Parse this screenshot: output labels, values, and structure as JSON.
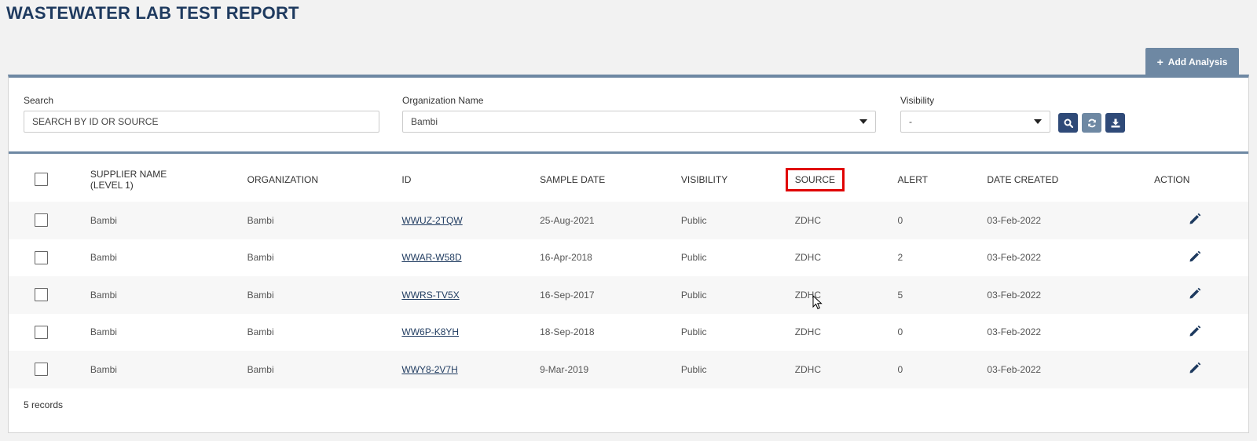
{
  "page": {
    "title": "WASTEWATER LAB TEST REPORT"
  },
  "toolbar": {
    "add_analysis_label": "Add Analysis",
    "add_icon": "plus-icon"
  },
  "filters": {
    "search": {
      "label": "Search",
      "placeholder": "SEARCH BY ID OR SOURCE",
      "value": ""
    },
    "organization": {
      "label": "Organization Name",
      "value": "Bambi"
    },
    "visibility": {
      "label": "Visibility",
      "value": "-"
    },
    "buttons": [
      {
        "name": "search-button",
        "icon": "search-icon",
        "color": "#2f4a78"
      },
      {
        "name": "refresh-button",
        "icon": "refresh-icon",
        "color": "#6e88a3"
      },
      {
        "name": "download-button",
        "icon": "download-icon",
        "color": "#2f4a78"
      }
    ]
  },
  "table": {
    "columns": {
      "supplier": "SUPPLIER NAME",
      "supplier_level": "(LEVEL 1)",
      "organization": "ORGANIZATION",
      "id": "ID",
      "sample_date": "SAMPLE DATE",
      "visibility": "VISIBILITY",
      "source": "SOURCE",
      "alert": "ALERT",
      "date_created": "DATE CREATED",
      "action": "ACTION"
    },
    "highlighted_column": "SOURCE",
    "highlight_color": "#e00000",
    "rows": [
      {
        "supplier": "Bambi",
        "organization": "Bambi",
        "id": "WWUZ-2TQW",
        "sample_date": "25-Aug-2021",
        "visibility": "Public",
        "source": "ZDHC",
        "alert": "0",
        "date_created": "03-Feb-2022"
      },
      {
        "supplier": "Bambi",
        "organization": "Bambi",
        "id": "WWAR-W58D",
        "sample_date": "16-Apr-2018",
        "visibility": "Public",
        "source": "ZDHC",
        "alert": "2",
        "date_created": "03-Feb-2022"
      },
      {
        "supplier": "Bambi",
        "organization": "Bambi",
        "id": "WWRS-TV5X",
        "sample_date": "16-Sep-2017",
        "visibility": "Public",
        "source": "ZDHC",
        "alert": "5",
        "date_created": "03-Feb-2022"
      },
      {
        "supplier": "Bambi",
        "organization": "Bambi",
        "id": "WW6P-K8YH",
        "sample_date": "18-Sep-2018",
        "visibility": "Public",
        "source": "ZDHC",
        "alert": "0",
        "date_created": "03-Feb-2022"
      },
      {
        "supplier": "Bambi",
        "organization": "Bambi",
        "id": "WWY8-2V7H",
        "sample_date": "9-Mar-2019",
        "visibility": "Public",
        "source": "ZDHC",
        "alert": "0",
        "date_created": "03-Feb-2022"
      }
    ],
    "row_action_icon": "pencil-icon"
  },
  "footer": {
    "records_text": "5 records"
  },
  "colors": {
    "title": "#1e3a5f",
    "accent": "#6e88a3",
    "primary": "#2f4a78"
  }
}
